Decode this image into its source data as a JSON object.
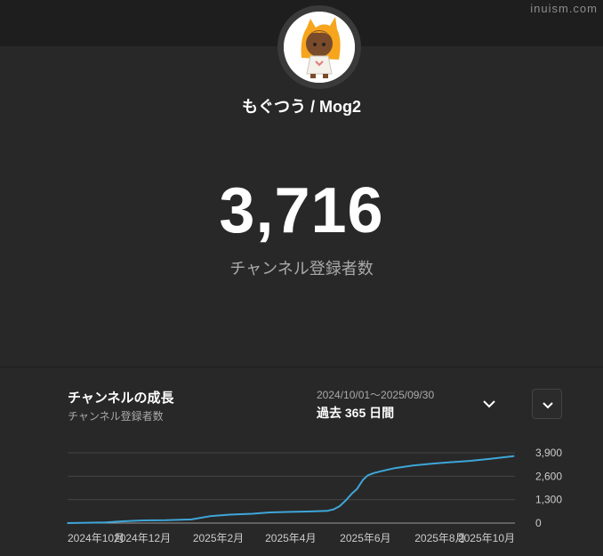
{
  "watermark": "inuism.com",
  "channel": {
    "name": "もぐつう / Mog2"
  },
  "subscribers": {
    "count": "3,716",
    "label": "チャンネル登録者数"
  },
  "growth": {
    "title": "チャンネルの成長",
    "subtitle": "チャンネル登録者数",
    "date_range": "2024/10/01～2025/09/30",
    "period": "過去 365 日間"
  },
  "colors": {
    "background": "#282828",
    "line": "#3ea6d8",
    "grid": "#444444",
    "text_muted": "#aaaaaa"
  },
  "icons": {
    "period_dropdown": "chevron-down-icon",
    "expand_button": "chevron-down-icon"
  },
  "chart_data": {
    "type": "line",
    "x": [
      "2024-10-01",
      "2024-11-01",
      "2024-11-15",
      "2024-12-01",
      "2024-12-20",
      "2025-01-10",
      "2025-01-25",
      "2025-02-10",
      "2025-03-01",
      "2025-03-15",
      "2025-04-01",
      "2025-04-15",
      "2025-05-01",
      "2025-05-06",
      "2025-05-11",
      "2025-05-16",
      "2025-05-21",
      "2025-05-25",
      "2025-05-30",
      "2025-06-03",
      "2025-06-08",
      "2025-06-15",
      "2025-06-25",
      "2025-07-10",
      "2025-07-25",
      "2025-08-10",
      "2025-08-25",
      "2025-09-10",
      "2025-09-30"
    ],
    "values": [
      0,
      40,
      100,
      150,
      160,
      200,
      380,
      470,
      520,
      590,
      620,
      640,
      680,
      760,
      940,
      1260,
      1640,
      1880,
      2400,
      2650,
      2780,
      2900,
      3050,
      3200,
      3300,
      3380,
      3450,
      3560,
      3716
    ],
    "ylim": [
      0,
      3900
    ],
    "yticks": [
      0,
      1300,
      2600,
      3900
    ],
    "ytick_labels": [
      "0",
      "1,300",
      "2,600",
      "3,900"
    ],
    "xticks": [
      {
        "date": "2024-10-01",
        "label": "2024年10月"
      },
      {
        "date": "2024-12-01",
        "label": "2024年12月"
      },
      {
        "date": "2025-02-01",
        "label": "2025年2月"
      },
      {
        "date": "2025-04-01",
        "label": "2025年4月"
      },
      {
        "date": "2025-06-01",
        "label": "2025年6月"
      },
      {
        "date": "2025-08-01",
        "label": "2025年8月"
      },
      {
        "date": "2025-10-01",
        "label": "2025年10月"
      }
    ],
    "xrange": [
      "2024-10-01",
      "2025-10-01"
    ],
    "grid": true
  }
}
